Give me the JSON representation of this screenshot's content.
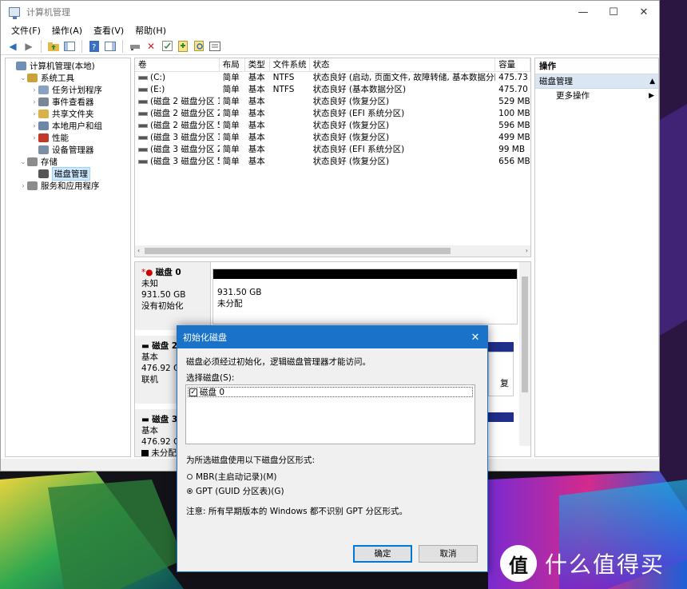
{
  "window": {
    "title": "计算机管理",
    "controls": {
      "minimize": "—",
      "maximize": "☐",
      "close": "✕"
    }
  },
  "menu": [
    "文件(F)",
    "操作(A)",
    "查看(V)",
    "帮助(H)"
  ],
  "tree": [
    {
      "label": "计算机管理(本地)",
      "indent": 0,
      "twisty": "",
      "icon": "computer-icon",
      "color": "#6f8fb7"
    },
    {
      "label": "系统工具",
      "indent": 1,
      "twisty": "⌄",
      "icon": "tools-icon",
      "color": "#c9a23a"
    },
    {
      "label": "任务计划程序",
      "indent": 2,
      "twisty": "›",
      "icon": "clock-icon",
      "color": "#8aa2c0"
    },
    {
      "label": "事件查看器",
      "indent": 2,
      "twisty": "›",
      "icon": "event-viewer-icon",
      "color": "#7a8796"
    },
    {
      "label": "共享文件夹",
      "indent": 2,
      "twisty": "›",
      "icon": "shared-folder-icon",
      "color": "#d9b04a"
    },
    {
      "label": "本地用户和组",
      "indent": 2,
      "twisty": "›",
      "icon": "users-icon",
      "color": "#6d87a6"
    },
    {
      "label": "性能",
      "indent": 2,
      "twisty": "›",
      "icon": "performance-icon",
      "color": "#c0392b"
    },
    {
      "label": "设备管理器",
      "indent": 2,
      "twisty": "",
      "icon": "device-manager-icon",
      "color": "#7c8ea3"
    },
    {
      "label": "存储",
      "indent": 1,
      "twisty": "⌄",
      "icon": "storage-icon",
      "color": "#8c8c8c"
    },
    {
      "label": "磁盘管理",
      "indent": 2,
      "twisty": "",
      "icon": "disk-management-icon",
      "color": "#555555",
      "selected": true
    },
    {
      "label": "服务和应用程序",
      "indent": 1,
      "twisty": "›",
      "icon": "services-icon",
      "color": "#8c8c8c"
    }
  ],
  "volumes": {
    "headers": [
      "卷",
      "布局",
      "类型",
      "文件系统",
      "状态",
      "容量"
    ],
    "rows": [
      [
        "(C:)",
        "简单",
        "基本",
        "NTFS",
        "状态良好 (启动, 页面文件, 故障转储, 基本数据分区)",
        "475.73 G"
      ],
      [
        "(E:)",
        "简单",
        "基本",
        "NTFS",
        "状态良好 (基本数据分区)",
        "475.70 G"
      ],
      [
        "(磁盘 2 磁盘分区 1)",
        "简单",
        "基本",
        "",
        "状态良好 (恢复分区)",
        "529 MB"
      ],
      [
        "(磁盘 2 磁盘分区 2)",
        "简单",
        "基本",
        "",
        "状态良好 (EFI 系统分区)",
        "100 MB"
      ],
      [
        "(磁盘 2 磁盘分区 5)",
        "简单",
        "基本",
        "",
        "状态良好 (恢复分区)",
        "596 MB"
      ],
      [
        "(磁盘 3 磁盘分区 1)",
        "简单",
        "基本",
        "",
        "状态良好 (恢复分区)",
        "499 MB"
      ],
      [
        "(磁盘 3 磁盘分区 2)",
        "简单",
        "基本",
        "",
        "状态良好 (EFI 系统分区)",
        "99 MB"
      ],
      [
        "(磁盘 3 磁盘分区 5)",
        "简单",
        "基本",
        "",
        "状态良好 (恢复分区)",
        "656 MB"
      ]
    ]
  },
  "disks": {
    "disk0": {
      "name": "磁盘 0",
      "type": "未知",
      "size": "931.50 GB",
      "state": "没有初始化",
      "part_size": "931.50 GB",
      "part_state": "未分配"
    },
    "disk2": {
      "name": "磁盘 2",
      "type": "基本",
      "size": "476.92 GB",
      "state": "联机",
      "part_fragment": "复"
    },
    "disk3": {
      "name": "磁盘 3",
      "type": "基本",
      "size": "476.92 GB",
      "legend": "未分配"
    }
  },
  "actions": {
    "header": "操作",
    "section": "磁盘管理",
    "more": "更多操作"
  },
  "dialog": {
    "title": "初始化磁盘",
    "message": "磁盘必须经过初始化，逻辑磁盘管理器才能访问。",
    "select_label": "选择磁盘(S):",
    "disk_item": "磁盘 0",
    "style_label": "为所选磁盘使用以下磁盘分区形式:",
    "mbr_label": "MBR(主启动记录)(M)",
    "gpt_label": "GPT (GUID 分区表)(G)",
    "note": "注意: 所有早期版本的 Windows 都不识别 GPT 分区形式。",
    "ok_label": "确定",
    "cancel_label": "取消"
  },
  "watermark": {
    "logo": "值",
    "text": "什么值得买"
  }
}
